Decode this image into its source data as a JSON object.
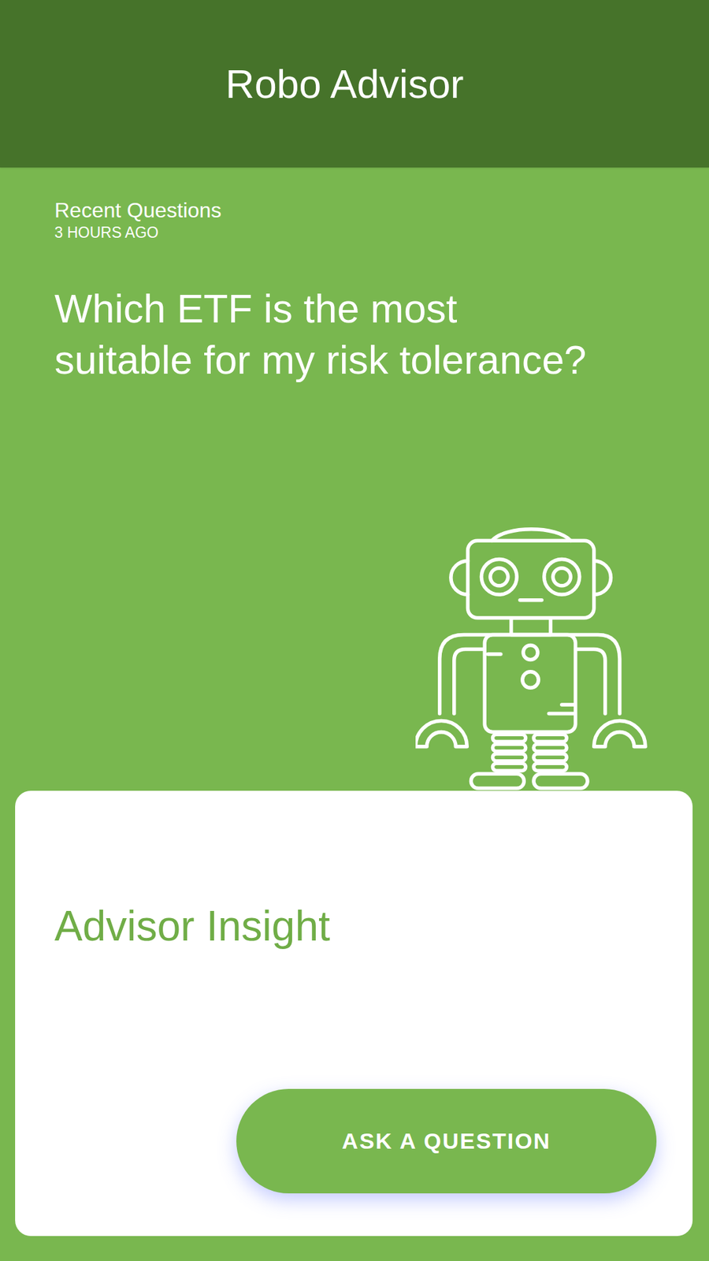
{
  "header": {
    "title": "Robo Advisor"
  },
  "recent": {
    "label": "Recent Questions",
    "time": "3 HOURS AGO",
    "question": "Which ETF is the most suitable for my risk tolerance?"
  },
  "card": {
    "title": "Advisor Insight",
    "button": "ASK A QUESTION"
  }
}
